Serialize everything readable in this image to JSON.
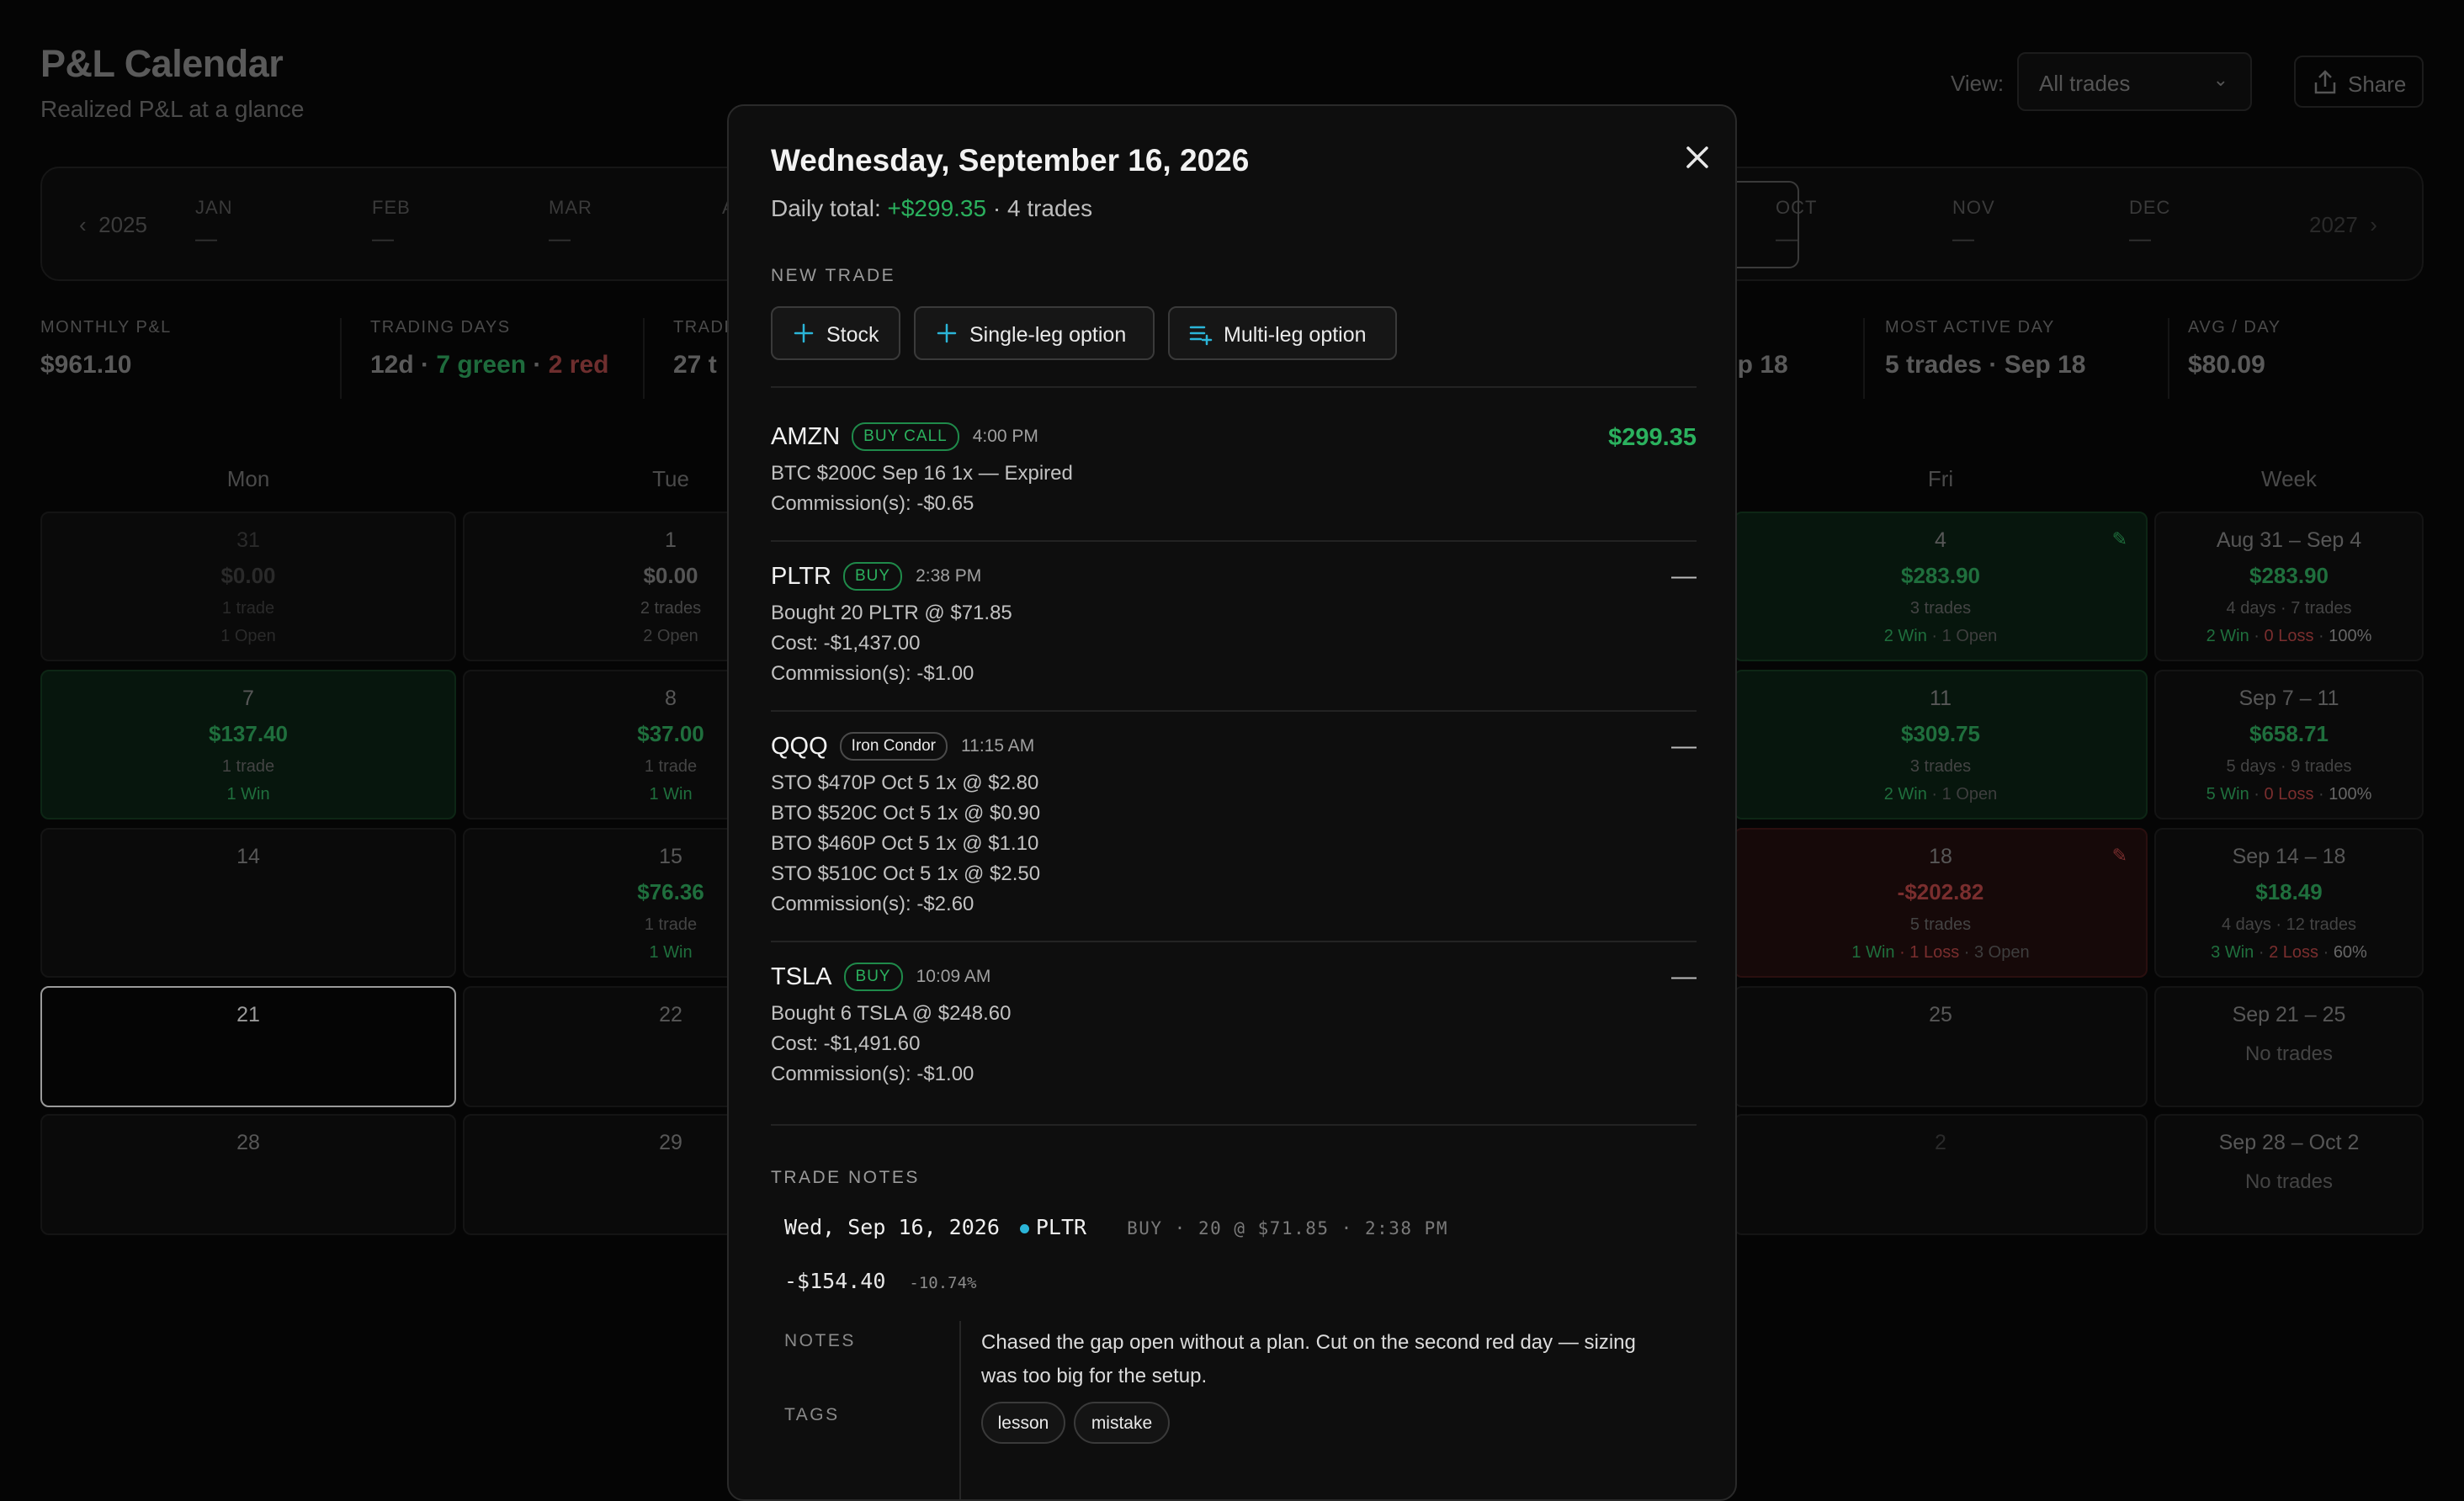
{
  "header": {
    "title": "P&L Calendar",
    "subtitle": "Realized P&L at a glance",
    "view_label": "View:",
    "view_value": "All trades",
    "share_label": "Share"
  },
  "month_bar": {
    "prev_year": "2025",
    "next_year": "2027",
    "months": [
      {
        "label": "JAN",
        "value": "—"
      },
      {
        "label": "FEB",
        "value": "—"
      },
      {
        "label": "MAR",
        "value": "—"
      },
      {
        "label": "A",
        "value": ""
      },
      {
        "label": "OCT",
        "value": "—"
      },
      {
        "label": "NOV",
        "value": "—"
      },
      {
        "label": "DEC",
        "value": "—"
      }
    ]
  },
  "stats": {
    "monthly_pl": {
      "label": "MONTHLY P&L",
      "value": "$961.10"
    },
    "trading_days": {
      "label": "TRADING DAYS",
      "days": "12d",
      "sep": " · ",
      "green": "7 green",
      "red": "2 red"
    },
    "trades": {
      "label": "TRADE",
      "value": "27 t"
    },
    "worst": {
      "value": "ep 18"
    },
    "most_active": {
      "label": "MOST ACTIVE DAY",
      "value": "5 trades · Sep 18"
    },
    "avg_day": {
      "label": "AVG / DAY",
      "value": "$80.09"
    }
  },
  "calendar": {
    "dow": {
      "mon": "Mon",
      "tue": "Tue",
      "fri": "Fri",
      "week": "Week"
    },
    "mon": [
      {
        "day": "31",
        "pl": "$0.00",
        "trades": "1 trade",
        "status": "1 Open"
      },
      {
        "day": "7",
        "pl": "$137.40",
        "trades": "1 trade",
        "status": "1 Win"
      },
      {
        "day": "14"
      },
      {
        "day": "21"
      },
      {
        "day": "28"
      }
    ],
    "tue": [
      {
        "day": "1",
        "pl": "$0.00",
        "trades": "2 trades",
        "status": "2 Open"
      },
      {
        "day": "8",
        "pl": "$37.00",
        "trades": "1 trade",
        "status": "1 Win"
      },
      {
        "day": "15",
        "pl": "$76.36",
        "trades": "1 trade",
        "status": "1 Win"
      },
      {
        "day": "22"
      },
      {
        "day": "29"
      }
    ],
    "fri": [
      {
        "day": "4",
        "pl": "$283.90",
        "trades": "3 trades",
        "win": "2 Win",
        "rest": " · 1 Open"
      },
      {
        "day": "11",
        "pl": "$309.75",
        "trades": "3 trades",
        "win": "2 Win",
        "rest": " · 1 Open"
      },
      {
        "day": "18",
        "pl": "-$202.82",
        "trades": "5 trades",
        "win": "1 Win",
        "loss": " · 1 Loss",
        "rest": " · 3 Open"
      },
      {
        "day": "25"
      },
      {
        "day": "2"
      }
    ],
    "week": [
      {
        "range": "Aug 31 – Sep 4",
        "pl": "$283.90",
        "summary": "4 days · 7 trades",
        "win": "2 Win",
        "loss": "0 Loss",
        "rate": "100%"
      },
      {
        "range": "Sep 7 – 11",
        "pl": "$658.71",
        "summary": "5 days · 9 trades",
        "win": "5 Win",
        "loss": "0 Loss",
        "rate": "100%"
      },
      {
        "range": "Sep 14 – 18",
        "pl": "$18.49",
        "summary": "4 days · 12 trades",
        "win": "3 Win",
        "loss": "2 Loss",
        "rate": "60%"
      },
      {
        "range": "Sep 21 – 25",
        "summary": "No trades"
      },
      {
        "range": "Sep 28 – Oct 2",
        "summary": "No trades"
      }
    ]
  },
  "modal": {
    "date": "Wednesday, September 16, 2026",
    "daily_label": "Daily total: ",
    "daily_value": "+$299.35",
    "daily_trades": " · 4 trades",
    "new_trade_label": "NEW TRADE",
    "buttons": {
      "stock": "Stock",
      "single": "Single-leg option",
      "multi": "Multi-leg option"
    },
    "trades": [
      {
        "symbol": "AMZN",
        "badge": "BUY CALL",
        "time": "4:00 PM",
        "amount": "$299.35",
        "lines": [
          "BTC $200C Sep 16 1x — Expired",
          "Commission(s): -$0.65"
        ]
      },
      {
        "symbol": "PLTR",
        "badge": "BUY",
        "time": "2:38 PM",
        "amount": "—",
        "lines": [
          "Bought 20 PLTR @ $71.85",
          "Cost: -$1,437.00",
          "Commission(s): -$1.00"
        ]
      },
      {
        "symbol": "QQQ",
        "badge": "Iron Condor",
        "time": "11:15 AM",
        "amount": "—",
        "lines": [
          "STO $470P Oct 5 1x @ $2.80",
          "BTO $520C Oct 5 1x @ $0.90",
          "BTO $460P Oct 5 1x @ $1.10",
          "STO $510C Oct 5 1x @ $2.50",
          "Commission(s): -$2.60"
        ]
      },
      {
        "symbol": "TSLA",
        "badge": "BUY",
        "time": "10:09 AM",
        "amount": "—",
        "lines": [
          "Bought 6 TSLA @ $248.60",
          "Cost: -$1,491.60",
          "Commission(s): -$1.00"
        ]
      }
    ],
    "notes_header": "TRADE NOTES",
    "note": {
      "date": "Wed, Sep 16, 2026",
      "symbol": "PLTR",
      "meta": "BUY · 20 @ $71.85 · 2:38 PM",
      "pl": "-$154.40",
      "pct": "-10.74%",
      "notes_label": "NOTES",
      "notes_text": "Chased the gap open without a plan. Cut on the second red day — sizing was too big for the setup.",
      "tags_label": "TAGS",
      "tags": [
        "lesson",
        "mistake"
      ]
    }
  },
  "colors": {
    "green": "#2bb15e",
    "cyan": "#2bb5d8",
    "red": "#d05555"
  }
}
